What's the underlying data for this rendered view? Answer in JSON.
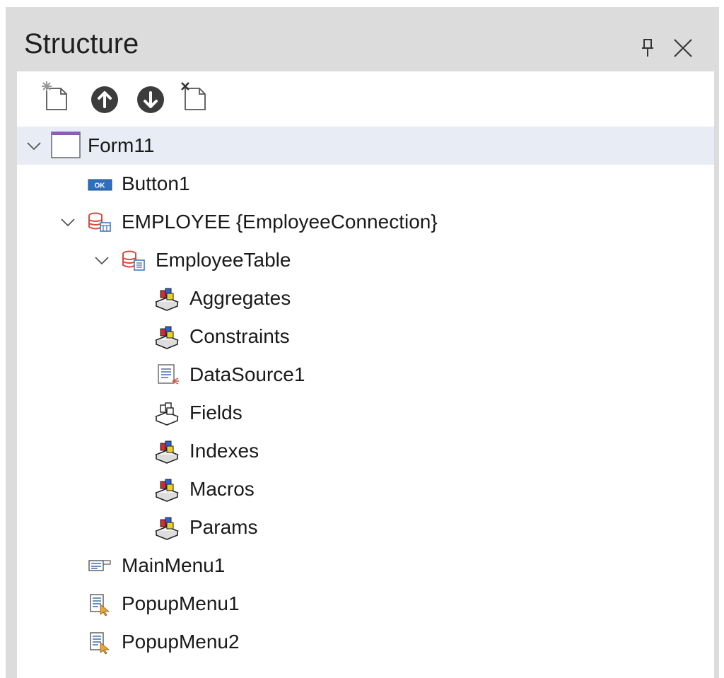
{
  "panel": {
    "title": "Structure"
  },
  "header_buttons": [
    {
      "name": "pin-icon",
      "tooltip": ""
    },
    {
      "name": "close-icon",
      "tooltip": ""
    }
  ],
  "toolbar": [
    {
      "name": "new-item-icon"
    },
    {
      "name": "move-up-icon"
    },
    {
      "name": "move-down-icon"
    },
    {
      "name": "delete-item-icon"
    }
  ],
  "tree": {
    "items": [
      {
        "label": "Form11",
        "icon": "form-icon",
        "level": 0,
        "expanded": true,
        "selected": true
      },
      {
        "label": "Button1",
        "icon": "button-component-icon",
        "level": 1
      },
      {
        "label": "EMPLOYEE {EmployeeConnection}",
        "icon": "database-connection-icon",
        "level": 1,
        "expanded": true
      },
      {
        "label": "EmployeeTable",
        "icon": "database-table-icon",
        "level": 2,
        "expanded": true
      },
      {
        "label": "Aggregates",
        "icon": "collection-colored-icon",
        "level": 3
      },
      {
        "label": "Constraints",
        "icon": "collection-colored-icon",
        "level": 3
      },
      {
        "label": "DataSource1",
        "icon": "datasource-icon",
        "level": 3
      },
      {
        "label": "Fields",
        "icon": "collection-plain-icon",
        "level": 3
      },
      {
        "label": "Indexes",
        "icon": "collection-colored-icon",
        "level": 3
      },
      {
        "label": "Macros",
        "icon": "collection-colored-icon",
        "level": 3
      },
      {
        "label": "Params",
        "icon": "collection-colored-icon",
        "level": 3
      },
      {
        "label": "MainMenu1",
        "icon": "main-menu-icon",
        "level": 1
      },
      {
        "label": "PopupMenu1",
        "icon": "popup-menu-icon",
        "level": 1
      },
      {
        "label": "PopupMenu2",
        "icon": "popup-menu-icon",
        "level": 1
      }
    ]
  },
  "colors": {
    "header_bg": "#dcdcdc",
    "panel_bg": "#ffffff",
    "selected_row": "#e8ecf4",
    "form_icon_accent": "#8e5bb5",
    "button_icon_blue": "#2e6fbe",
    "db_red": "#d64b3d",
    "toolbar_dark": "#3c3c3c"
  }
}
